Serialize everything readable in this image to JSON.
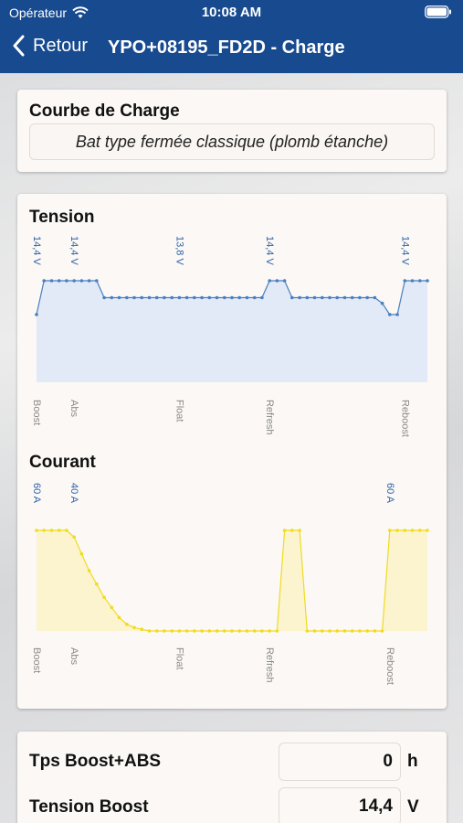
{
  "status": {
    "carrier": "Opérateur",
    "time": "10:08 AM"
  },
  "nav": {
    "back_label": "Retour",
    "title": "YPO+08195_FD2D - Charge"
  },
  "curve": {
    "title": "Courbe de Charge",
    "selected": "Bat type fermée classique (plomb étanche)"
  },
  "tension": {
    "title": "Tension",
    "top_labels": [
      "14,4 V",
      "14,4 V",
      "13,8 V",
      "14,4 V",
      "14,4 V"
    ],
    "phase_labels": [
      "Boost",
      "Abs",
      "Float",
      "Refresh",
      "Reboost"
    ]
  },
  "courant": {
    "title": "Courant",
    "top_labels": [
      "60 A",
      "40 A",
      "60 A"
    ],
    "phase_labels": [
      "Boost",
      "Abs",
      "Float",
      "Refresh",
      "Reboost"
    ]
  },
  "params": {
    "rows": [
      {
        "label": "Tps Boost+ABS",
        "value": "0",
        "unit": "h"
      },
      {
        "label": "Tension Boost",
        "value": "14,4",
        "unit": "V"
      }
    ]
  },
  "colors": {
    "nav": "#174a8f",
    "tension_line": "#4a7fc0",
    "tension_fill": "#e3eaf7",
    "tension_text": "#2f63a8",
    "courant_line": "#f0dc1e",
    "courant_fill": "#fbf4cf",
    "courant_text": "#2f63a8"
  },
  "chart_data": [
    {
      "type": "line",
      "title": "Tension",
      "x": [
        0,
        1,
        2,
        3,
        4,
        5,
        6,
        7,
        8,
        9,
        10,
        11,
        12,
        13,
        14,
        15,
        16,
        17,
        18,
        19,
        20,
        21,
        22,
        23,
        24,
        25,
        26,
        27,
        28,
        29,
        30,
        31,
        32,
        33,
        34,
        35,
        36,
        37,
        38,
        39,
        40,
        41,
        42,
        43,
        44,
        45,
        46,
        47,
        48,
        49,
        50,
        51,
        52
      ],
      "series": [
        {
          "values": [
            13.2,
            14.4,
            14.4,
            14.4,
            14.4,
            14.4,
            14.4,
            14.4,
            14.4,
            13.8,
            13.8,
            13.8,
            13.8,
            13.8,
            13.8,
            13.8,
            13.8,
            13.8,
            13.8,
            13.8,
            13.8,
            13.8,
            13.8,
            13.8,
            13.8,
            13.8,
            13.8,
            13.8,
            13.8,
            13.8,
            13.8,
            14.4,
            14.4,
            14.4,
            13.8,
            13.8,
            13.8,
            13.8,
            13.8,
            13.8,
            13.8,
            13.8,
            13.8,
            13.8,
            13.8,
            13.8,
            13.6,
            13.2,
            13.2,
            14.4,
            14.4,
            14.4,
            14.4
          ]
        }
      ],
      "annotations": [
        "14,4 V",
        "14,4 V",
        "13,8 V",
        "14,4 V",
        "14,4 V"
      ],
      "phases": [
        "Boost",
        "Abs",
        "Float",
        "Refresh",
        "Reboost"
      ],
      "ylim": [
        10.8,
        15.6
      ]
    },
    {
      "type": "line",
      "title": "Courant",
      "x": [
        0,
        1,
        2,
        3,
        4,
        5,
        6,
        7,
        8,
        9,
        10,
        11,
        12,
        13,
        14,
        15,
        16,
        17,
        18,
        19,
        20,
        21,
        22,
        23,
        24,
        25,
        26,
        27,
        28,
        29,
        30,
        31,
        32,
        33,
        34,
        35,
        36,
        37,
        38,
        39,
        40,
        41,
        42,
        43,
        44,
        45,
        46,
        47,
        48,
        49,
        50,
        51,
        52
      ],
      "series": [
        {
          "values": [
            60,
            60,
            60,
            60,
            60,
            56,
            46,
            36,
            28,
            20,
            14,
            8,
            4,
            2,
            1,
            0,
            0,
            0,
            0,
            0,
            0,
            0,
            0,
            0,
            0,
            0,
            0,
            0,
            0,
            0,
            0,
            0,
            0,
            60,
            60,
            60,
            0,
            0,
            0,
            0,
            0,
            0,
            0,
            0,
            0,
            0,
            0,
            60,
            60,
            60,
            60,
            60,
            60
          ]
        }
      ],
      "annotations": [
        "60 A",
        "40 A",
        "60 A"
      ],
      "phases": [
        "Boost",
        "Abs",
        "Float",
        "Refresh",
        "Reboost"
      ],
      "ylim": [
        0,
        60
      ]
    }
  ]
}
